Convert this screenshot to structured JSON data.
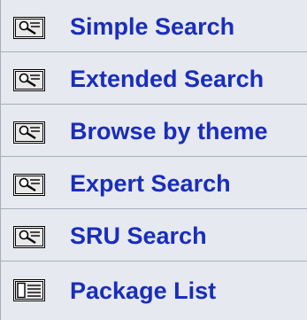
{
  "menu": {
    "items": [
      {
        "label": "Simple Search",
        "icon": "magnifier-icon"
      },
      {
        "label": "Extended Search",
        "icon": "magnifier-icon"
      },
      {
        "label": "Browse by theme",
        "icon": "magnifier-icon"
      },
      {
        "label": "Expert Search",
        "icon": "magnifier-icon"
      },
      {
        "label": "SRU Search",
        "icon": "magnifier-icon"
      },
      {
        "label": "Package List",
        "icon": "package-list-icon"
      }
    ]
  },
  "colors": {
    "link": "#1a2dbd",
    "background": "#e6e9ef",
    "divider": "#a7adbb"
  }
}
